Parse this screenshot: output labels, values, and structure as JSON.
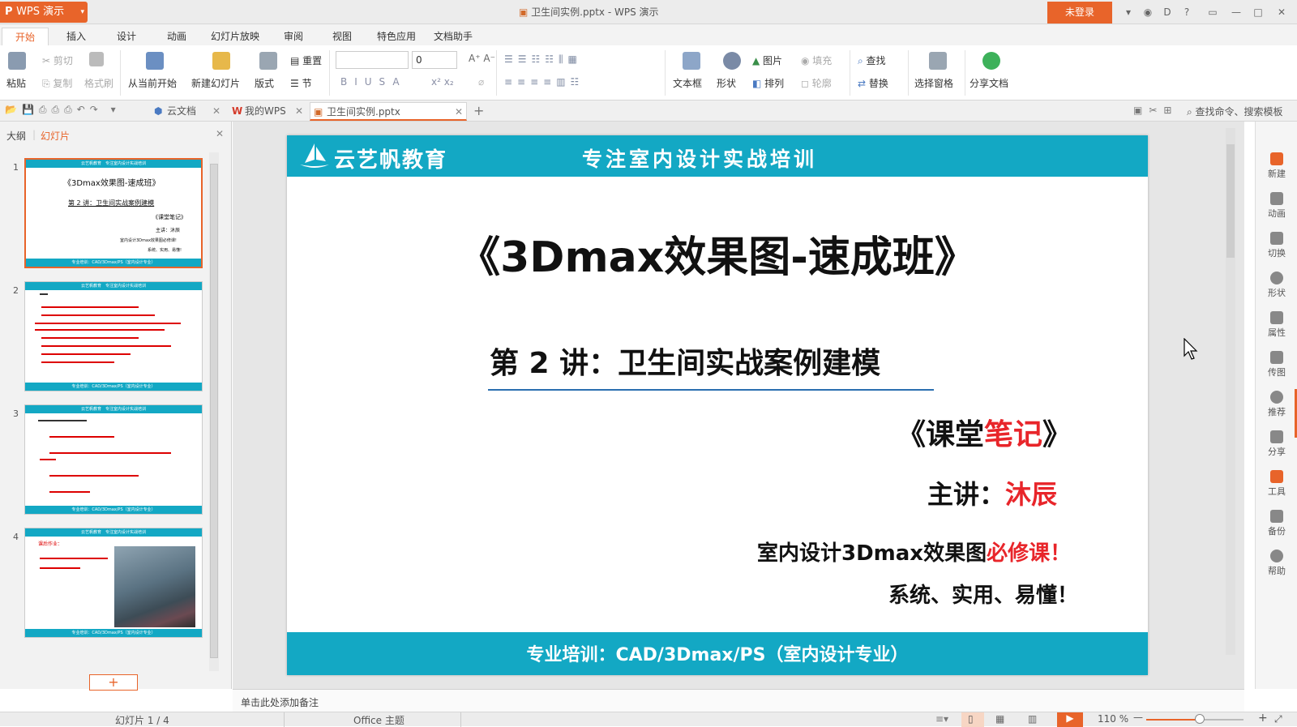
{
  "titlebar": {
    "app_name": "WPS 演示",
    "doc_title": "卫生间实例.pptx - WPS 演示",
    "login": "未登录",
    "window_icons": [
      "▾",
      "◉",
      "D",
      "?",
      "▭",
      "—",
      "□",
      "✕"
    ]
  },
  "menu": [
    "开始",
    "插入",
    "设计",
    "动画",
    "幻灯片放映",
    "审阅",
    "视图",
    "特色应用",
    "文档助手"
  ],
  "ribbon": {
    "paste": "粘贴",
    "cut": "剪切",
    "copy": "复制",
    "format_painter": "格式刷",
    "from_current": "从当前开始",
    "new_slide": "新建幻灯片",
    "layout": "版式",
    "reset": "重置",
    "section": "节",
    "font_size": "0",
    "textbox": "文本框",
    "shape": "形状",
    "picture": "图片",
    "arrange": "排列",
    "fill": "填充",
    "outline": "轮廓",
    "find": "查找",
    "replace": "替换",
    "selection_pane": "选择窗格",
    "share_doc": "分享文档"
  },
  "tabs": {
    "cloud": "云文档",
    "mywps": "我的WPS",
    "current": "卫生间实例.pptx",
    "search": "查找命令、搜索模板"
  },
  "leftpane": {
    "outline": "大纲",
    "slides": "幻灯片",
    "add": "+",
    "thumbs": [
      {
        "num": "1",
        "header": "云艺帆教育　专注室内设计实战培训",
        "title": "《3Dmax效果图-速成班》",
        "sub": "第 2 讲：卫生间实战案例建模",
        "note": "《课堂笔记》",
        "speaker": "主讲：沐辰",
        "line1": "室内设计3Dmax效果图必修课!",
        "line2": "系统、实用、易懂!",
        "footer": "专业培训：CAD/3Dmax/PS（室内设计专业）"
      },
      {
        "num": "2",
        "header": "云艺帆教育　专注室内设计实战培训",
        "footer": "专业培训：CAD/3Dmax/PS（室内设计专业）"
      },
      {
        "num": "3",
        "header": "云艺帆教育　专注室内设计实战培训",
        "footer": "专业培训：CAD/3Dmax/PS（室内设计专业）"
      },
      {
        "num": "4",
        "header": "云艺帆教育　专注室内设计实战培训",
        "homework": "课后作业：",
        "footer": "专业培训：CAD/3Dmax/PS（室内设计专业）"
      }
    ]
  },
  "slide": {
    "brand": "云艺帆教育",
    "slogan": "专注室内设计实战培训",
    "title": "《3Dmax效果图-速成班》",
    "lecture": "第 2 讲：卫生间实战案例建模",
    "note_open": "《课堂",
    "note_red": "笔记",
    "note_close": "》",
    "speaker_label": "主讲：",
    "speaker_name": "沐辰",
    "course_black": "室内设计3Dmax效果图",
    "course_red": "必修课！",
    "tagline": "系统、实用、易懂！",
    "footer": "专业培训：CAD/3Dmax/PS（室内设计专业）",
    "accent": "#13a8c4",
    "red": "#e8252a"
  },
  "rail": [
    "新建",
    "动画",
    "切换",
    "形状",
    "属性",
    "传图",
    "推荐",
    "分享",
    "工具",
    "备份",
    "帮助"
  ],
  "notes": "单击此处添加备注",
  "status": {
    "slide_count": "幻灯片 1 / 4",
    "theme": "Office 主题",
    "zoom": "110 %"
  }
}
